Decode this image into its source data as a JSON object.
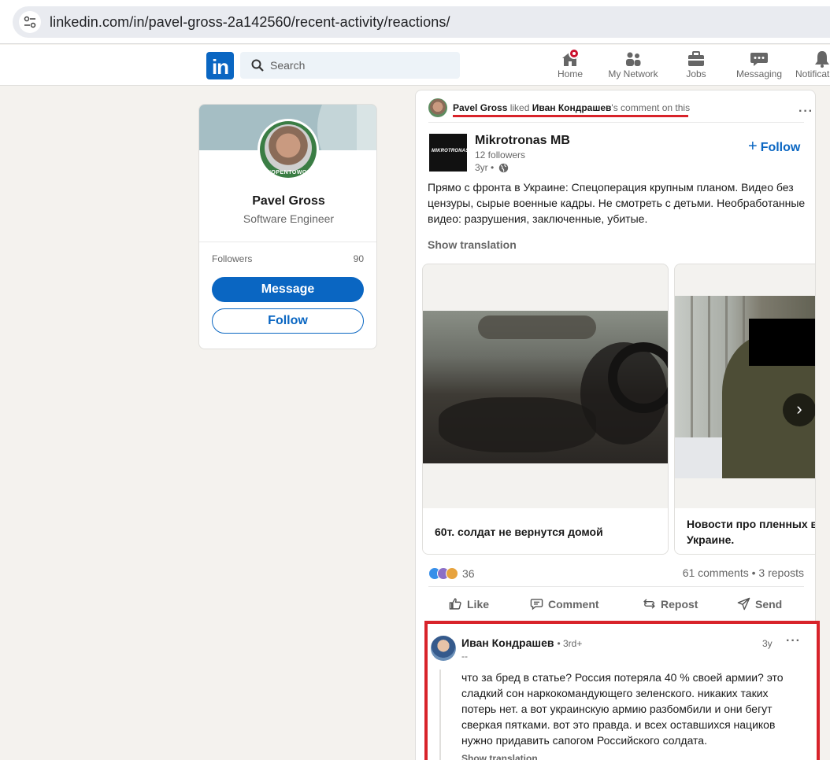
{
  "browser": {
    "url": "linkedin.com/in/pavel-gross-2a142560/recent-activity/reactions/"
  },
  "header": {
    "logo": "in",
    "search_placeholder": "Search",
    "nav": [
      {
        "label": "Home",
        "icon": "home-icon"
      },
      {
        "label": "My Network",
        "icon": "network-icon"
      },
      {
        "label": "Jobs",
        "icon": "jobs-icon"
      },
      {
        "label": "Messaging",
        "icon": "messaging-icon"
      },
      {
        "label": "Notifications",
        "icon": "bell-icon"
      }
    ]
  },
  "profile": {
    "name": "Pavel Gross",
    "headline": "Software Engineer",
    "badge": "#OPENTOWORK",
    "followers_label": "Followers",
    "followers_count": "90",
    "message_label": "Message",
    "follow_label": "Follow"
  },
  "post": {
    "context": {
      "actor": "Pavel Gross",
      "verb": " liked ",
      "target": "Иван Кондрашев",
      "suffix": "'s comment on this"
    },
    "org": {
      "name": "Mikrotronas MB",
      "logo_text": "MIKROTRONAS",
      "followers": "12 followers",
      "time": "3yr •",
      "follow_label": "Follow"
    },
    "text": "Прямо с фронта в Украине: Спецоперация крупным планом. Видео без цензуры, сырые военные кадры. Не смотреть с детьми. Необработанные видео: разрушения, заключенные, убитые.",
    "show_translation": "Show translation",
    "slides": [
      {
        "caption": "60т. солдат не вернутся домой"
      },
      {
        "caption": "Новости про пленных во Украине."
      }
    ],
    "reaction_count": "36",
    "comments_reposts": "61 comments • 3 reposts",
    "actions": {
      "like": "Like",
      "comment": "Comment",
      "repost": "Repost",
      "send": "Send"
    }
  },
  "comment": {
    "author": "Иван Кондрашев",
    "degree": "• 3rd+",
    "subtitle": "--",
    "time": "3y",
    "text": "что за бред в статье? Россия потеряла 40 % своей армии? это сладкий сон наркокомандующего зеленского. никаких таких потерь нет. а вот украинскую армию разбомбили и они бегут сверкая пятками. вот это правда. и всех оставшихся нациков нужно придавить сапогом Российского солдата.",
    "show_translation": "Show translation"
  },
  "colors": {
    "brand": "#0a66c2",
    "highlight": "#d8232a",
    "background": "#f4f2ee"
  }
}
